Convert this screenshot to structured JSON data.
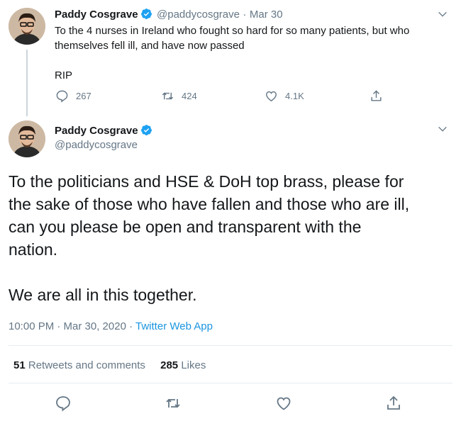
{
  "author": {
    "name": "Paddy Cosgrave",
    "handle": "@paddycosgrave"
  },
  "first_tweet": {
    "date": "Mar 30",
    "text_line1": "To the 4 nurses in Ireland who fought so hard for so many patients, but who",
    "text_line2": "themselves fell ill, and have now passed",
    "text_line3": "RIP",
    "replies": "267",
    "retweets": "424",
    "likes": "4.1K"
  },
  "main_tweet": {
    "line1": "To the politicians and HSE & DoH top brass, please for",
    "line2": "the sake of those who have fallen and those who are ill,",
    "line3": "can you please be open and transparent with the",
    "line4": "nation.",
    "line5": "We are all in this together.",
    "timestamp": "10:00 PM · Mar 30, 2020",
    "separator": "·",
    "source": "Twitter Web App",
    "retweets_count": "51",
    "retweets_label": "Retweets and comments",
    "likes_count": "285",
    "likes_label": "Likes"
  },
  "colors": {
    "accent": "#1da1f2",
    "link": "#1b95e0",
    "muted": "#657786"
  },
  "icons": [
    "verified-badge-icon",
    "chevron-down-icon",
    "reply-icon",
    "retweet-icon",
    "like-icon",
    "share-icon"
  ]
}
